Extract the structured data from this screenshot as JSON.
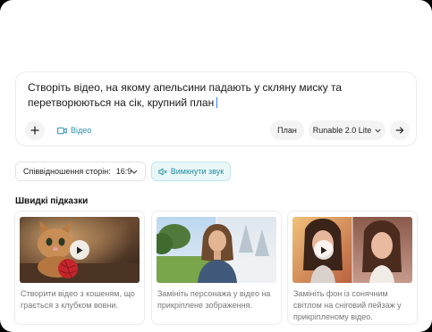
{
  "prompt": {
    "text": "Створіть відео, на якому апельсини падають у скляну миску та перетворюються на сік, крупний план"
  },
  "toolbar": {
    "add_icon": "plus-icon",
    "video_label": "Відео",
    "plan_label": "План",
    "model_label": "Runable 2.0 Lite",
    "send_icon": "arrow-right-icon"
  },
  "controls": {
    "aspect_label": "Співвідношення сторін:",
    "aspect_value": "16:9",
    "sound_label": "Вимкнути звук"
  },
  "suggestions": {
    "title": "Швидкі підказки",
    "items": [
      {
        "text": "Створити відео з кошеням, що грається з клубком вовни."
      },
      {
        "text": "Замініть персонажа у відео на прикріплене зображення."
      },
      {
        "text": "Замініть фон із сонячним світлом на сніговий пейзаж у прикріпленому відео."
      }
    ]
  },
  "colors": {
    "accent": "#1f8da3",
    "accent_bg": "#eaf7f9",
    "border": "#ececec"
  }
}
